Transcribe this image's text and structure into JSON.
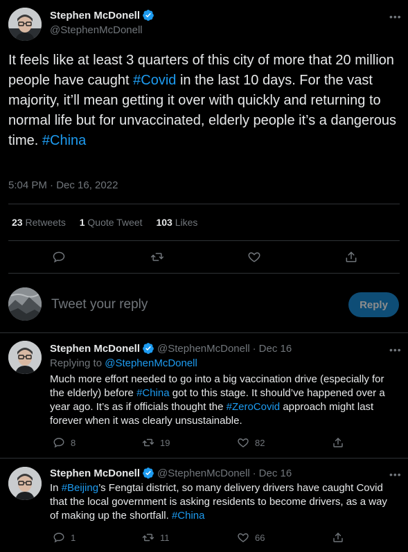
{
  "main_tweet": {
    "author": {
      "name": "Stephen McDonell",
      "handle": "@StephenMcDonell",
      "verified": true,
      "avatar_icon": "avatar-man-glasses"
    },
    "text_parts": [
      {
        "text": "It feels like at least 3 quarters of this city of more that 20 million people have caught ",
        "link": false
      },
      {
        "text": "#Covid",
        "link": true
      },
      {
        "text": " in the last 10 days. For the vast majority, it’ll mean getting it over with quickly and returning to normal life but for unvaccinated, elderly people it’s a dangerous time. ",
        "link": false
      },
      {
        "text": "#China",
        "link": true
      }
    ],
    "timestamp": "5:04 PM · Dec 16, 2022",
    "stats": {
      "retweets_count": "23",
      "retweets_label": "Retweets",
      "quotes_count": "1",
      "quotes_label": "Quote Tweet",
      "likes_count": "103",
      "likes_label": "Likes"
    }
  },
  "reply_box": {
    "placeholder": "Tweet your reply",
    "button_label": "Reply",
    "avatar_icon": "avatar-landscape"
  },
  "replies": [
    {
      "name": "Stephen McDonell",
      "handle": "@StephenMcDonell",
      "date": "Dec 16",
      "replying_prefix": "Replying to ",
      "replying_handle": "@StephenMcDonell",
      "text_parts": [
        {
          "text": "Much more effort needed to go into a big vaccination drive (especially for the elderly) before ",
          "link": false
        },
        {
          "text": "#China",
          "link": true
        },
        {
          "text": " got to this stage. It should’ve happened over a year ago. It’s as if officials thought the ",
          "link": false
        },
        {
          "text": "#ZeroCovid",
          "link": true
        },
        {
          "text": " approach might last forever when it was clearly unsustainable.",
          "link": false
        }
      ],
      "reply_count": "8",
      "retweet_count": "19",
      "like_count": "82"
    },
    {
      "name": "Stephen McDonell",
      "handle": "@StephenMcDonell",
      "date": "Dec 16",
      "text_parts": [
        {
          "text": "In ",
          "link": false
        },
        {
          "text": "#Beijing",
          "link": true
        },
        {
          "text": "’s Fengtai district, so many delivery drivers have caught Covid that the local government is asking residents to become drivers, as a way of making up the shortfall. ",
          "link": false
        },
        {
          "text": "#China",
          "link": true
        }
      ],
      "reply_count": "1",
      "retweet_count": "11",
      "like_count": "66"
    }
  ],
  "colors": {
    "background": "#000000",
    "text": "#e7e9ea",
    "muted": "#71767b",
    "accent": "#1d9bf0",
    "divider": "#2f3336"
  }
}
